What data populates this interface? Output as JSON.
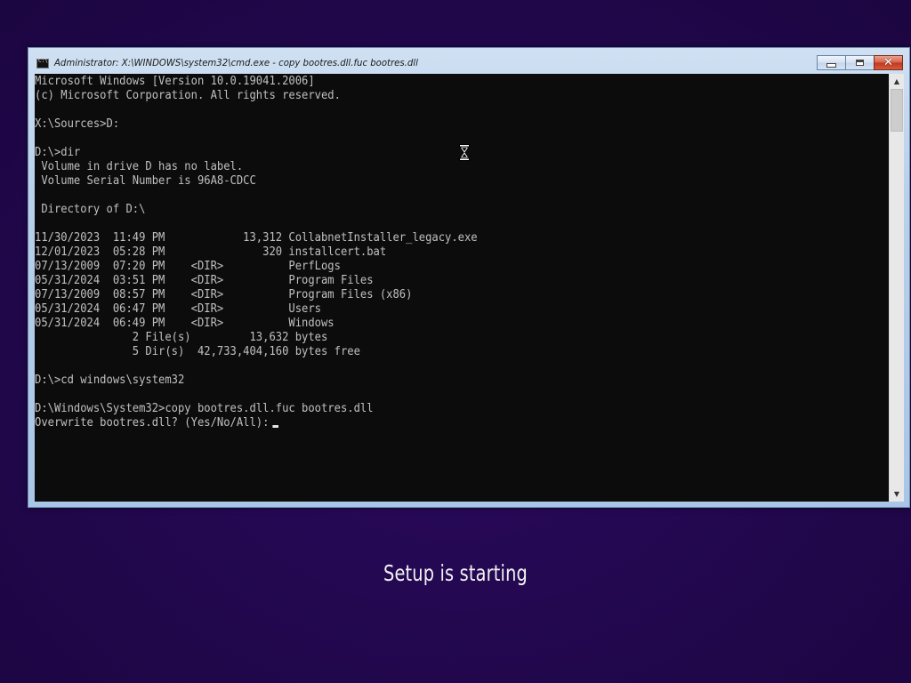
{
  "window": {
    "title": "Administrator: X:\\WINDOWS\\system32\\cmd.exe - copy  bootres.dll.fuc bootres.dll",
    "minimize_icon": "minimize-icon",
    "maximize_icon": "maximize-icon",
    "close_icon": "close-icon",
    "close_glyph": "✕"
  },
  "console": {
    "lines": [
      "Microsoft Windows [Version 10.0.19041.2006]",
      "(c) Microsoft Corporation. All rights reserved.",
      "",
      "X:\\Sources>D:",
      "",
      "D:\\>dir",
      " Volume in drive D has no label.",
      " Volume Serial Number is 96A8-CDCC",
      "",
      " Directory of D:\\",
      "",
      "11/30/2023  11:49 PM            13,312 CollabnetInstaller_legacy.exe",
      "12/01/2023  05:28 PM               320 installcert.bat",
      "07/13/2009  07:20 PM    <DIR>          PerfLogs",
      "05/31/2024  03:51 PM    <DIR>          Program Files",
      "07/13/2009  08:57 PM    <DIR>          Program Files (x86)",
      "05/31/2024  06:47 PM    <DIR>          Users",
      "05/31/2024  06:49 PM    <DIR>          Windows",
      "               2 File(s)         13,632 bytes",
      "               5 Dir(s)  42,733,404,160 bytes free",
      "",
      "D:\\>cd windows\\system32",
      "",
      "D:\\Windows\\System32>copy bootres.dll.fuc bootres.dll"
    ],
    "prompt_line": "Overwrite bootres.dll? (Yes/No/All):"
  },
  "scrollbar": {
    "up_arrow": "▲",
    "down_arrow": "▼"
  },
  "setup": {
    "status_text": "Setup is starting"
  },
  "colors": {
    "background": "#22084f",
    "console_bg": "#0c0c0c",
    "console_fg": "#c0c0c0",
    "close_button": "#c2361c"
  },
  "icons": {
    "title_icon": "cmd-icon",
    "mouse_cursor": "hourglass-icon"
  }
}
